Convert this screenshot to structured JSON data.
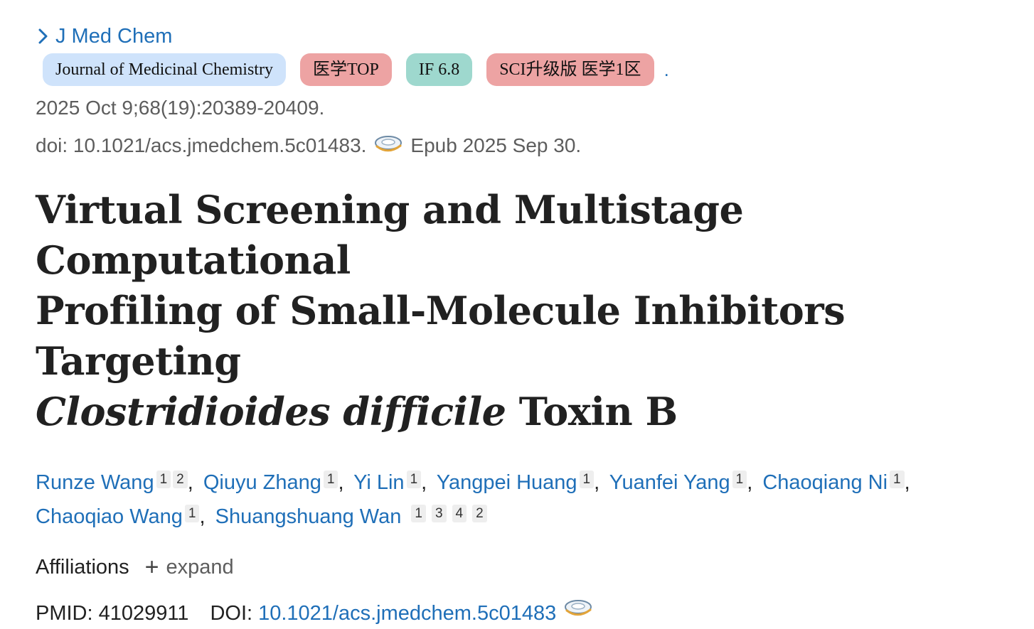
{
  "journal": {
    "abbrev": "J Med Chem",
    "badges": [
      {
        "label": "Journal of Medicinal Chemistry",
        "color": "#cfe3fb"
      },
      {
        "label": "医学TOP",
        "color": "#eda3a3"
      },
      {
        "label": "IF 6.8",
        "color": "#9ed8ce"
      },
      {
        "label": "SCI升级版 医学1区",
        "color": "#eda3a3"
      }
    ],
    "trailing_dot": "."
  },
  "citation": {
    "date_volume": "2025 Oct 9;68(19):20389-20409.",
    "doi_text": "doi: 10.1021/acs.jmedchem.5c01483.",
    "epub": "Epub 2025 Sep 30."
  },
  "title": {
    "line1": "Virtual Screening and Multistage Computational",
    "line2": "Profiling of Small-Molecule Inhibitors Targeting",
    "italic": "Clostridioides difficile",
    "tail": "Toxin B"
  },
  "authors": [
    {
      "name": "Runze Wang",
      "affils": [
        "1",
        "2"
      ]
    },
    {
      "name": "Qiuyu Zhang",
      "affils": [
        "1"
      ]
    },
    {
      "name": "Yi Lin",
      "affils": [
        "1"
      ]
    },
    {
      "name": "Yangpei Huang",
      "affils": [
        "1"
      ]
    },
    {
      "name": "Yuanfei Yang",
      "affils": [
        "1"
      ]
    },
    {
      "name": "Chaoqiang Ni",
      "affils": [
        "1"
      ]
    },
    {
      "name": "Chaoqiao Wang",
      "affils": [
        "1"
      ]
    },
    {
      "name": "Shuangshuang Wan",
      "affils": [
        "1",
        "3",
        "4",
        "2"
      ]
    }
  ],
  "affiliations": {
    "label": "Affiliations",
    "expand_label": "expand"
  },
  "ids": {
    "pmid_label": "PMID:",
    "pmid": "41029911",
    "doi_label": "DOI:",
    "doi": "10.1021/acs.jmedchem.5c01483"
  },
  "colors": {
    "link": "#1f6fb8",
    "muted": "#5d5d5d"
  }
}
